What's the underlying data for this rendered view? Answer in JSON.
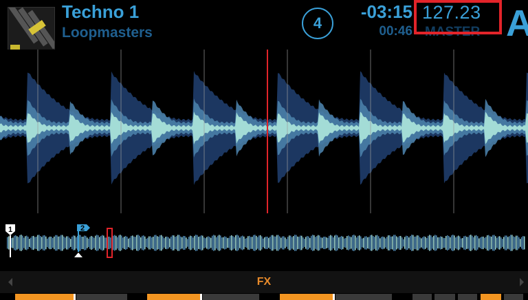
{
  "track": {
    "title": "Techno 1",
    "artist": "Loopmasters",
    "cover_icon": "album-cover"
  },
  "deck": {
    "beat_counter": "4",
    "remaining_time": "-03:15",
    "elapsed_time": "00:46",
    "tempo": "127.23",
    "sync_status": "MASTER",
    "deck_letter": "A"
  },
  "overview": {
    "cue_points": [
      "1",
      "2"
    ]
  },
  "fx": {
    "label": "FX"
  },
  "colors": {
    "accent_blue": "#3aa0d8",
    "dim_blue": "#1f5f8f",
    "highlight_red": "#e2242a",
    "playhead_red": "#e2242a",
    "fx_orange": "#f39521"
  }
}
